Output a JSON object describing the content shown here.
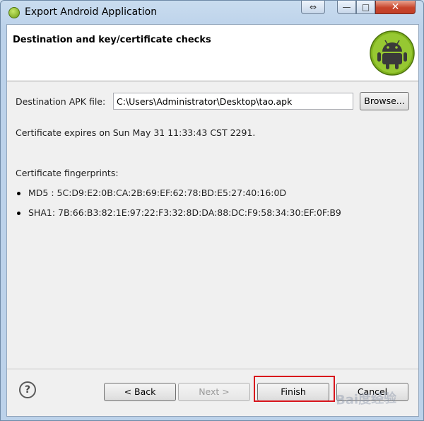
{
  "window": {
    "title": "Export Android Application",
    "caption_buttons": {
      "extra": "⇔",
      "minimize": "—",
      "maximize": "□",
      "close": "✕"
    }
  },
  "header": {
    "title": "Destination and key/certificate checks"
  },
  "destination": {
    "label": "Destination APK file:",
    "value": "C:\\Users\\Administrator\\Desktop\\tao.apk",
    "browse_label": "Browse..."
  },
  "certificate": {
    "expires": "Certificate expires on Sun May 31 11:33:43 CST 2291.",
    "fingerprints_label": "Certificate fingerprints:",
    "fingerprints": [
      "MD5 : 5C:D9:E2:0B:CA:2B:69:EF:62:78:BD:E5:27:40:16:0D",
      "SHA1: 7B:66:B3:82:1E:97:22:F3:32:8D:DA:88:DC:F9:58:34:30:EF:0F:B9"
    ]
  },
  "footer": {
    "help_symbol": "?",
    "back_label": "< Back",
    "next_label": "Next >",
    "finish_label": "Finish",
    "cancel_label": "Cancel"
  },
  "watermark": "Bai度经验",
  "colors": {
    "highlight": "#d9141c",
    "android_green": "#8fbf2a"
  }
}
